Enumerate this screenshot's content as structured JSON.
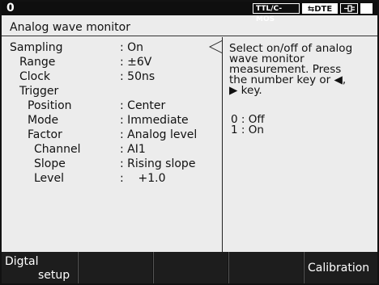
{
  "status": {
    "page_num": "0",
    "mode_badge": "TTL/C-MOS",
    "dte_badge": "⇆DTE",
    "icon_name": "cable-icon"
  },
  "title": "Analog wave monitor",
  "settings": [
    {
      "label": "Sampling",
      "value": ": On"
    },
    {
      "label": "Range",
      "value": ": ±6V"
    },
    {
      "label": "Clock",
      "value": ": 50ns"
    },
    {
      "label": "Trigger",
      "value": ""
    },
    {
      "label": "Position",
      "value": ": Center"
    },
    {
      "label": "Mode",
      "value": ": Immediate"
    },
    {
      "label": "Factor",
      "value": ": Analog level"
    },
    {
      "label": "Channel",
      "value": ": AI1"
    },
    {
      "label": "Slope",
      "value": ": Rising slope"
    },
    {
      "label": "Level",
      "value": ":    +1.0"
    }
  ],
  "help": {
    "lines": [
      "Select on/off of analog",
      "wave monitor",
      "measurement. Press",
      "the number key or ◀,",
      "▶ key."
    ],
    "options": [
      "0 : Off",
      "1 : On"
    ]
  },
  "function_keys": [
    {
      "line1": "Digtal",
      "line2": "setup"
    },
    {
      "line1": "",
      "line2": ""
    },
    {
      "line1": "",
      "line2": ""
    },
    {
      "line1": "",
      "line2": ""
    },
    {
      "line1": "Calibration",
      "line2": ""
    }
  ]
}
